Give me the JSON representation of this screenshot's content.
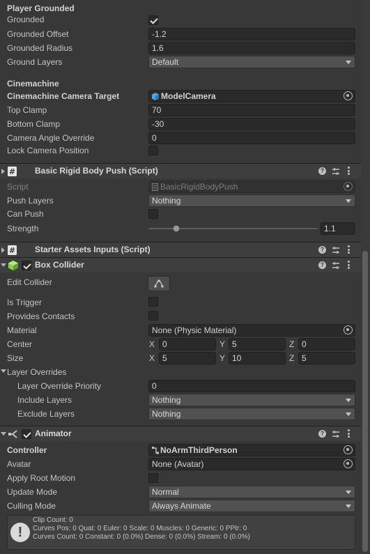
{
  "player_grounded": {
    "section_title": "Player Grounded",
    "grounded_label": "Grounded",
    "grounded_checked": true,
    "offset_label": "Grounded Offset",
    "offset_value": "-1.2",
    "radius_label": "Grounded Radius",
    "radius_value": "1.6",
    "layers_label": "Ground Layers",
    "layers_value": "Default"
  },
  "cinemachine": {
    "section_title": "Cinemachine",
    "target_label": "Cinemachine Camera Target",
    "target_value": "ModelCamera",
    "top_clamp_label": "Top Clamp",
    "top_clamp_value": "70",
    "bottom_clamp_label": "Bottom Clamp",
    "bottom_clamp_value": "-30",
    "angle_override_label": "Camera Angle Override",
    "angle_override_value": "0",
    "lock_label": "Lock Camera Position",
    "lock_checked": false
  },
  "rigid_push": {
    "title": "Basic Rigid Body Push (Script)",
    "script_label": "Script",
    "script_value": "BasicRigidBodyPush",
    "push_layers_label": "Push Layers",
    "push_layers_value": "Nothing",
    "can_push_label": "Can Push",
    "can_push_checked": false,
    "strength_label": "Strength",
    "strength_value": "1.1",
    "strength_fraction": 0.15
  },
  "starter_inputs": {
    "title": "Starter Assets Inputs (Script)"
  },
  "box_collider": {
    "title": "Box Collider",
    "enabled": true,
    "edit_label": "Edit Collider",
    "is_trigger_label": "Is Trigger",
    "provides_contacts_label": "Provides Contacts",
    "material_label": "Material",
    "material_value": "None (Physic Material)",
    "center_label": "Center",
    "center": {
      "x": "0",
      "y": "5",
      "z": "0"
    },
    "size_label": "Size",
    "size": {
      "x": "5",
      "y": "10",
      "z": "5"
    },
    "axis_x": "X",
    "axis_y": "Y",
    "axis_z": "Z",
    "layer_overrides_label": "Layer Overrides",
    "priority_label": "Layer Override Priority",
    "priority_value": "0",
    "include_label": "Include Layers",
    "include_value": "Nothing",
    "exclude_label": "Exclude Layers",
    "exclude_value": "Nothing"
  },
  "animator": {
    "title": "Animator",
    "enabled": true,
    "controller_label": "Controller",
    "controller_value": "NoArmThirdPerson",
    "avatar_label": "Avatar",
    "avatar_value": "None (Avatar)",
    "root_motion_label": "Apply Root Motion",
    "update_mode_label": "Update Mode",
    "update_mode_value": "Normal",
    "culling_label": "Culling Mode",
    "culling_value": "Always Animate",
    "info_lines": [
      "Clip Count: 0",
      "Curves Pos: 0 Quat: 0 Euler: 0 Scale: 0 Muscles: 0 Generic: 0 PPtr: 0",
      "Curves Count: 0 Constant: 0 (0.0%) Dense: 0 (0.0%) Stream: 0 (0.0%)"
    ]
  },
  "header_icons": {
    "help": "?",
    "script_icon": "#"
  }
}
